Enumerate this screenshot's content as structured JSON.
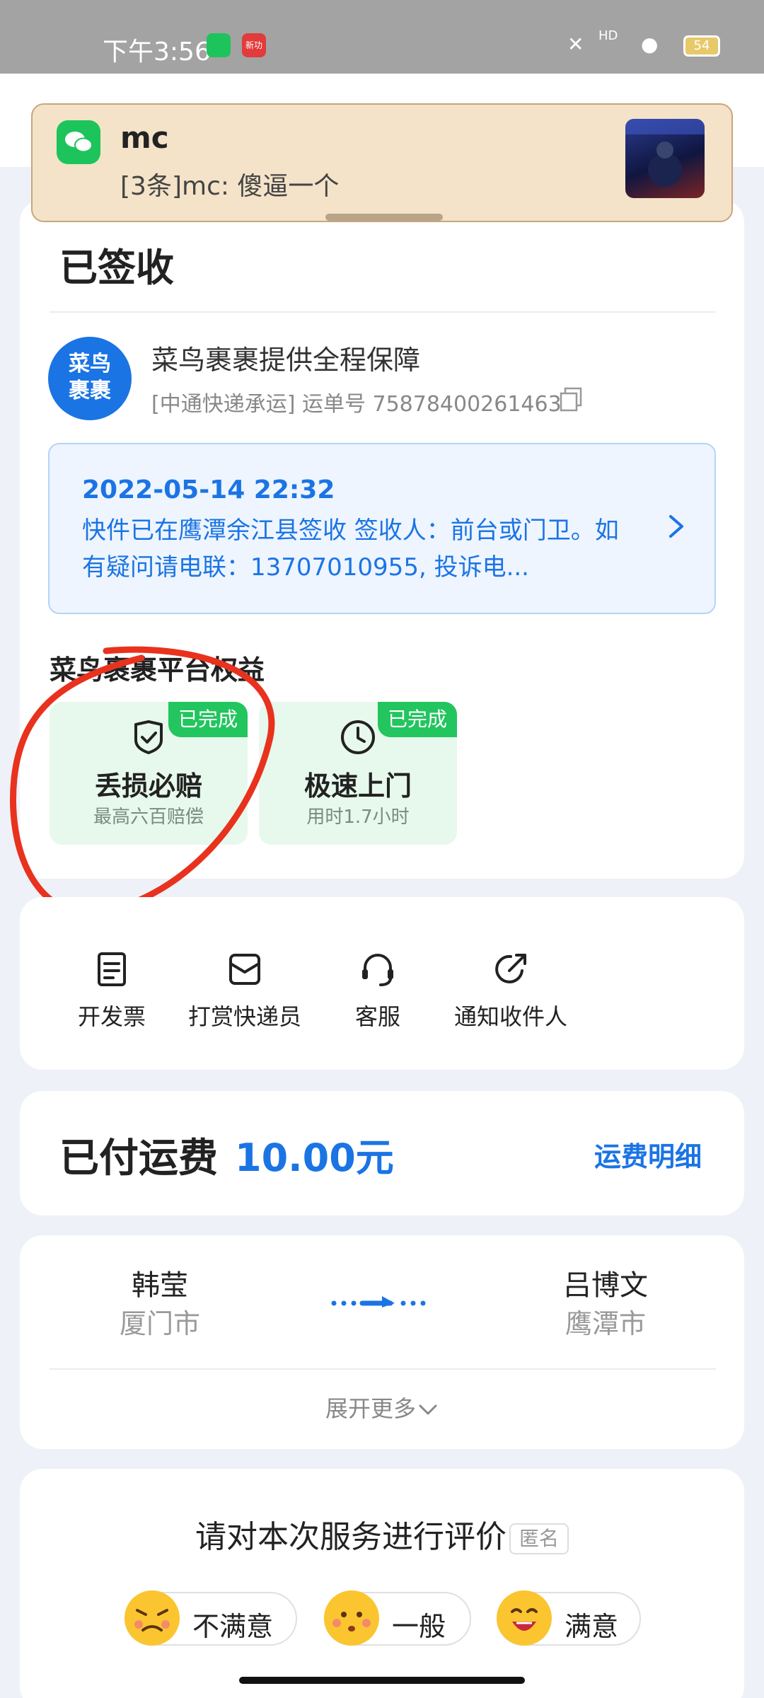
{
  "status_bar": {
    "time": "下午3:56",
    "app_icon_badge": "新功",
    "network_label": "HD",
    "battery": "54",
    "colors": {
      "wechat": "#1dc45c",
      "news": "#e23b3b"
    }
  },
  "notification": {
    "app": "wechat-icon",
    "title": "mc",
    "body": "[3条]mc: 傻逼一个"
  },
  "status_card": {
    "title": "已签收",
    "logo_text": "菜鸟裹裹",
    "guarantee": "菜鸟裹裹提供全程保障",
    "waybill": "[中通快递承运] 运单号 75878400261463",
    "tracking": {
      "time": "2022-05-14 22:32",
      "description": "快件已在鹰潭余江县签收 签收人：前台或门卫。如有疑问请电联：13707010955, 投诉电..."
    },
    "rights_title": "菜鸟裹裹平台权益",
    "rights": [
      {
        "badge": "已完成",
        "name": "丢损必赔",
        "sub": "最高六百赔偿"
      },
      {
        "badge": "已完成",
        "name": "极速上门",
        "sub": "用时1.7小时"
      }
    ]
  },
  "actions": [
    {
      "label": "开发票",
      "icon": "invoice-icon"
    },
    {
      "label": "打赏快递员",
      "icon": "tip-courier-icon"
    },
    {
      "label": "客服",
      "icon": "headset-icon"
    },
    {
      "label": "通知收件人",
      "icon": "share-icon"
    }
  ],
  "fee": {
    "label": "已付运费",
    "value": "10.00元",
    "detail": "运费明细"
  },
  "route": {
    "sender_name": "韩莹",
    "sender_city": "厦门市",
    "receiver_name": "吕博文",
    "receiver_city": "鹰潭市",
    "expand": "展开更多"
  },
  "rating": {
    "title": "请对本次服务进行评价",
    "anonymous": "匿名",
    "options": [
      "不满意",
      "一般",
      "满意"
    ]
  },
  "accent_color": "#1b74e4"
}
